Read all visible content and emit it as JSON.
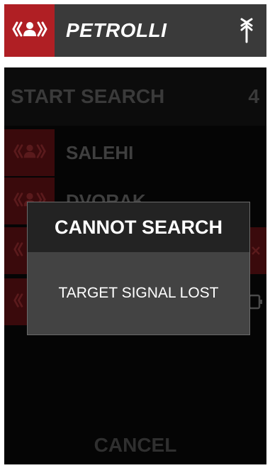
{
  "header": {
    "title": "PETROLLI",
    "beacon_icon": "signal-person-icon",
    "antenna_icon": "antenna-icon",
    "accent": "#b01f24"
  },
  "search": {
    "start_label": "START SEARCH",
    "count": "4"
  },
  "contacts": [
    {
      "name": "SALEHI"
    },
    {
      "name": "DVORAK"
    }
  ],
  "footer": {
    "cancel_label": "CANCEL"
  },
  "dialog": {
    "title": "CANNOT SEARCH",
    "message": "TARGET SIGNAL LOST"
  }
}
